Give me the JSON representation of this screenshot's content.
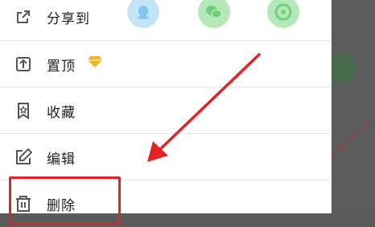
{
  "menu": {
    "items": [
      {
        "label": "分享到",
        "icon": "share-icon"
      },
      {
        "label": "置顶",
        "icon": "pin-top-icon",
        "badge_icon": "vip-diamond-icon"
      },
      {
        "label": "收藏",
        "icon": "bookmark-star-icon"
      },
      {
        "label": "编辑",
        "icon": "edit-icon"
      },
      {
        "label": "删除",
        "icon": "trash-icon"
      }
    ],
    "share_targets": [
      {
        "icon": "qq-icon",
        "color": "#bfe3f7",
        "fg": "#7cc6ee"
      },
      {
        "icon": "wechat-icon",
        "color": "#aee6b2",
        "fg": "#6ccf78"
      },
      {
        "icon": "moments-icon",
        "color": "#aee6b2",
        "fg": "#6ccf78"
      }
    ]
  },
  "annotation": {
    "arrow_color": "#e02424",
    "highlight_color": "#d42a2a"
  }
}
